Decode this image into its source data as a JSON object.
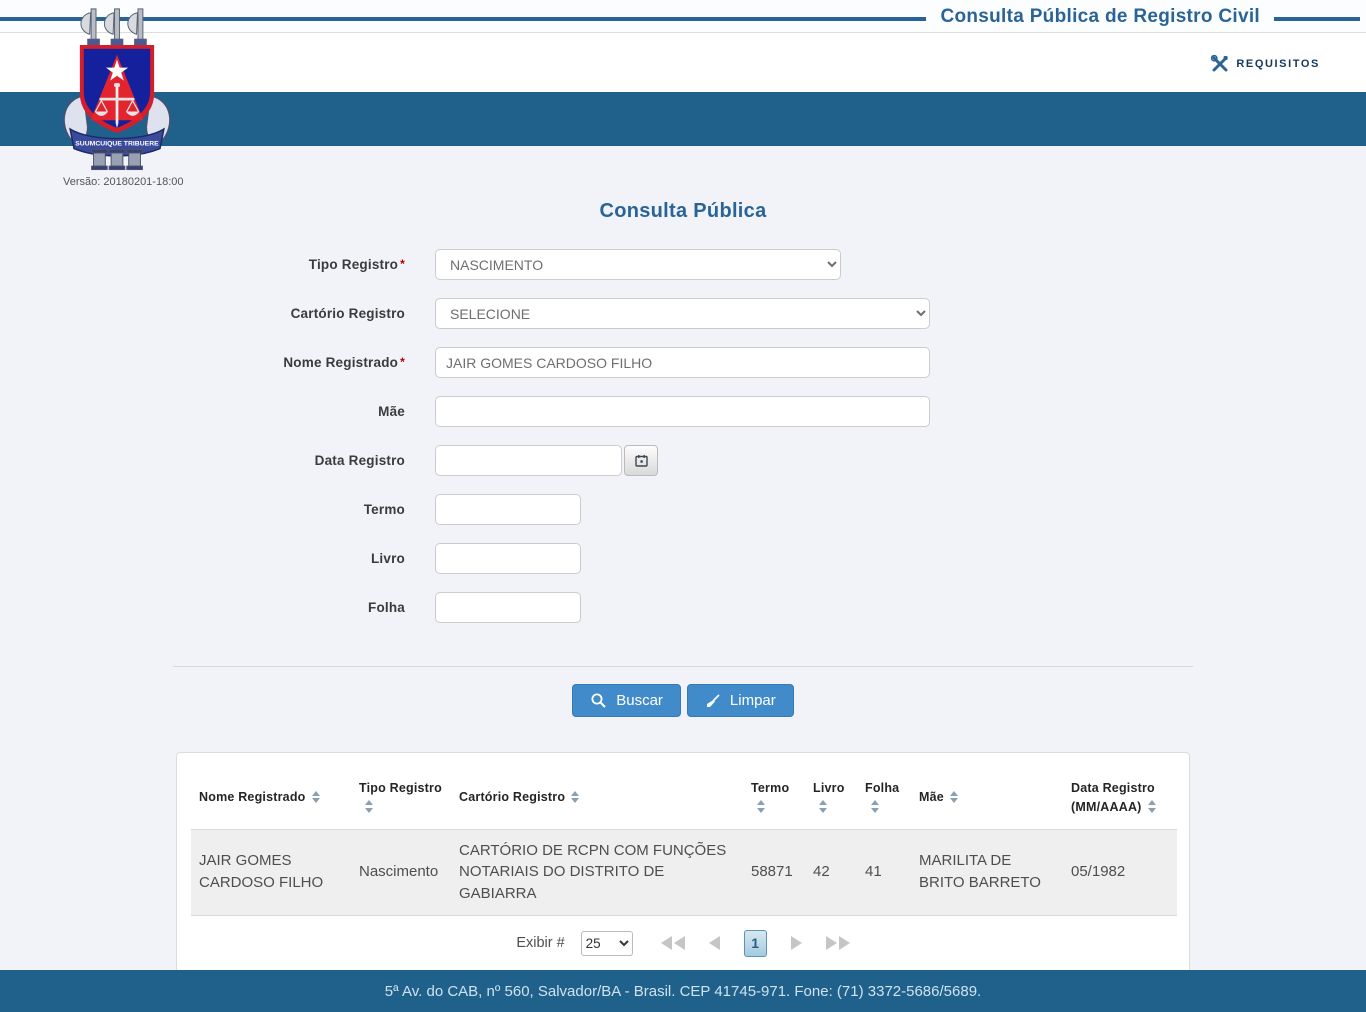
{
  "colors": {
    "brand_blue": "#20618c",
    "title_blue": "#2a6496",
    "button_blue": "#428bca"
  },
  "header": {
    "title": "Consulta Pública de Registro Civil",
    "requisitos_label": "REQUISITOS",
    "version": "Versão: 20180201-18:00",
    "logo_motto": "SUUMCUIQUE TRIBUERE"
  },
  "form": {
    "title": "Consulta Pública",
    "required_marker": "*",
    "fields": {
      "tipo_registro": {
        "label": "Tipo Registro",
        "value": "NASCIMENTO"
      },
      "cartorio_registro": {
        "label": "Cartório Registro",
        "value": "SELECIONE"
      },
      "nome_registrado": {
        "label": "Nome Registrado",
        "value": "JAIR GOMES CARDOSO FILHO"
      },
      "mae": {
        "label": "Mãe",
        "value": ""
      },
      "data_registro": {
        "label": "Data Registro",
        "value": ""
      },
      "termo": {
        "label": "Termo",
        "value": ""
      },
      "livro": {
        "label": "Livro",
        "value": ""
      },
      "folha": {
        "label": "Folha",
        "value": ""
      }
    },
    "buttons": {
      "buscar": "Buscar",
      "limpar": "Limpar"
    }
  },
  "results": {
    "columns": [
      "Nome Registrado",
      "Tipo Registro",
      "Cartório Registro",
      "Termo",
      "Livro",
      "Folha",
      "Mãe",
      "Data Registro (MM/AAAA)"
    ],
    "rows": [
      {
        "nome_registrado": "JAIR GOMES CARDOSO FILHO",
        "tipo_registro": "Nascimento",
        "cartorio_registro": "CARTÓRIO DE RCPN COM FUNÇÕES NOTARIAIS DO DISTRITO DE GABIARRA",
        "termo": "58871",
        "livro": "42",
        "folha": "41",
        "mae": "MARILITA DE BRITO BARRETO",
        "data_registro": "05/1982"
      }
    ],
    "pagination": {
      "exibir_label": "Exibir #",
      "page_size": "25",
      "current_page": "1"
    }
  },
  "footer": {
    "address": "5ª Av. do CAB, nº 560, Salvador/BA - Brasil. CEP 41745-971. Fone: (71) 3372-5686/5689."
  }
}
